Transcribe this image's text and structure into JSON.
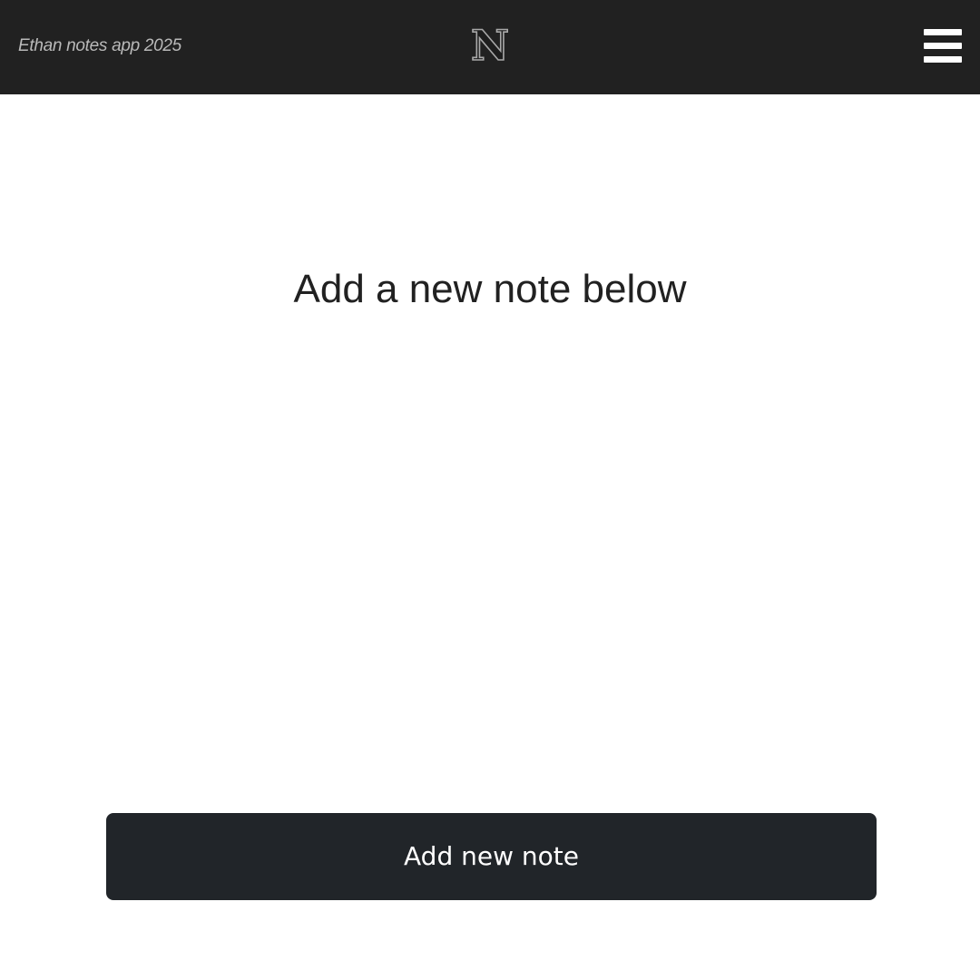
{
  "header": {
    "app_title": "Ethan notes app 2025",
    "logo_letter": "N",
    "logo_icon": "n-letter-logo-icon",
    "menu_icon": "hamburger-menu-icon",
    "background_color": "#212121"
  },
  "main": {
    "heading": "Add a new note below"
  },
  "actions": {
    "add_note_label": "Add new note",
    "button_color": "#212529"
  }
}
